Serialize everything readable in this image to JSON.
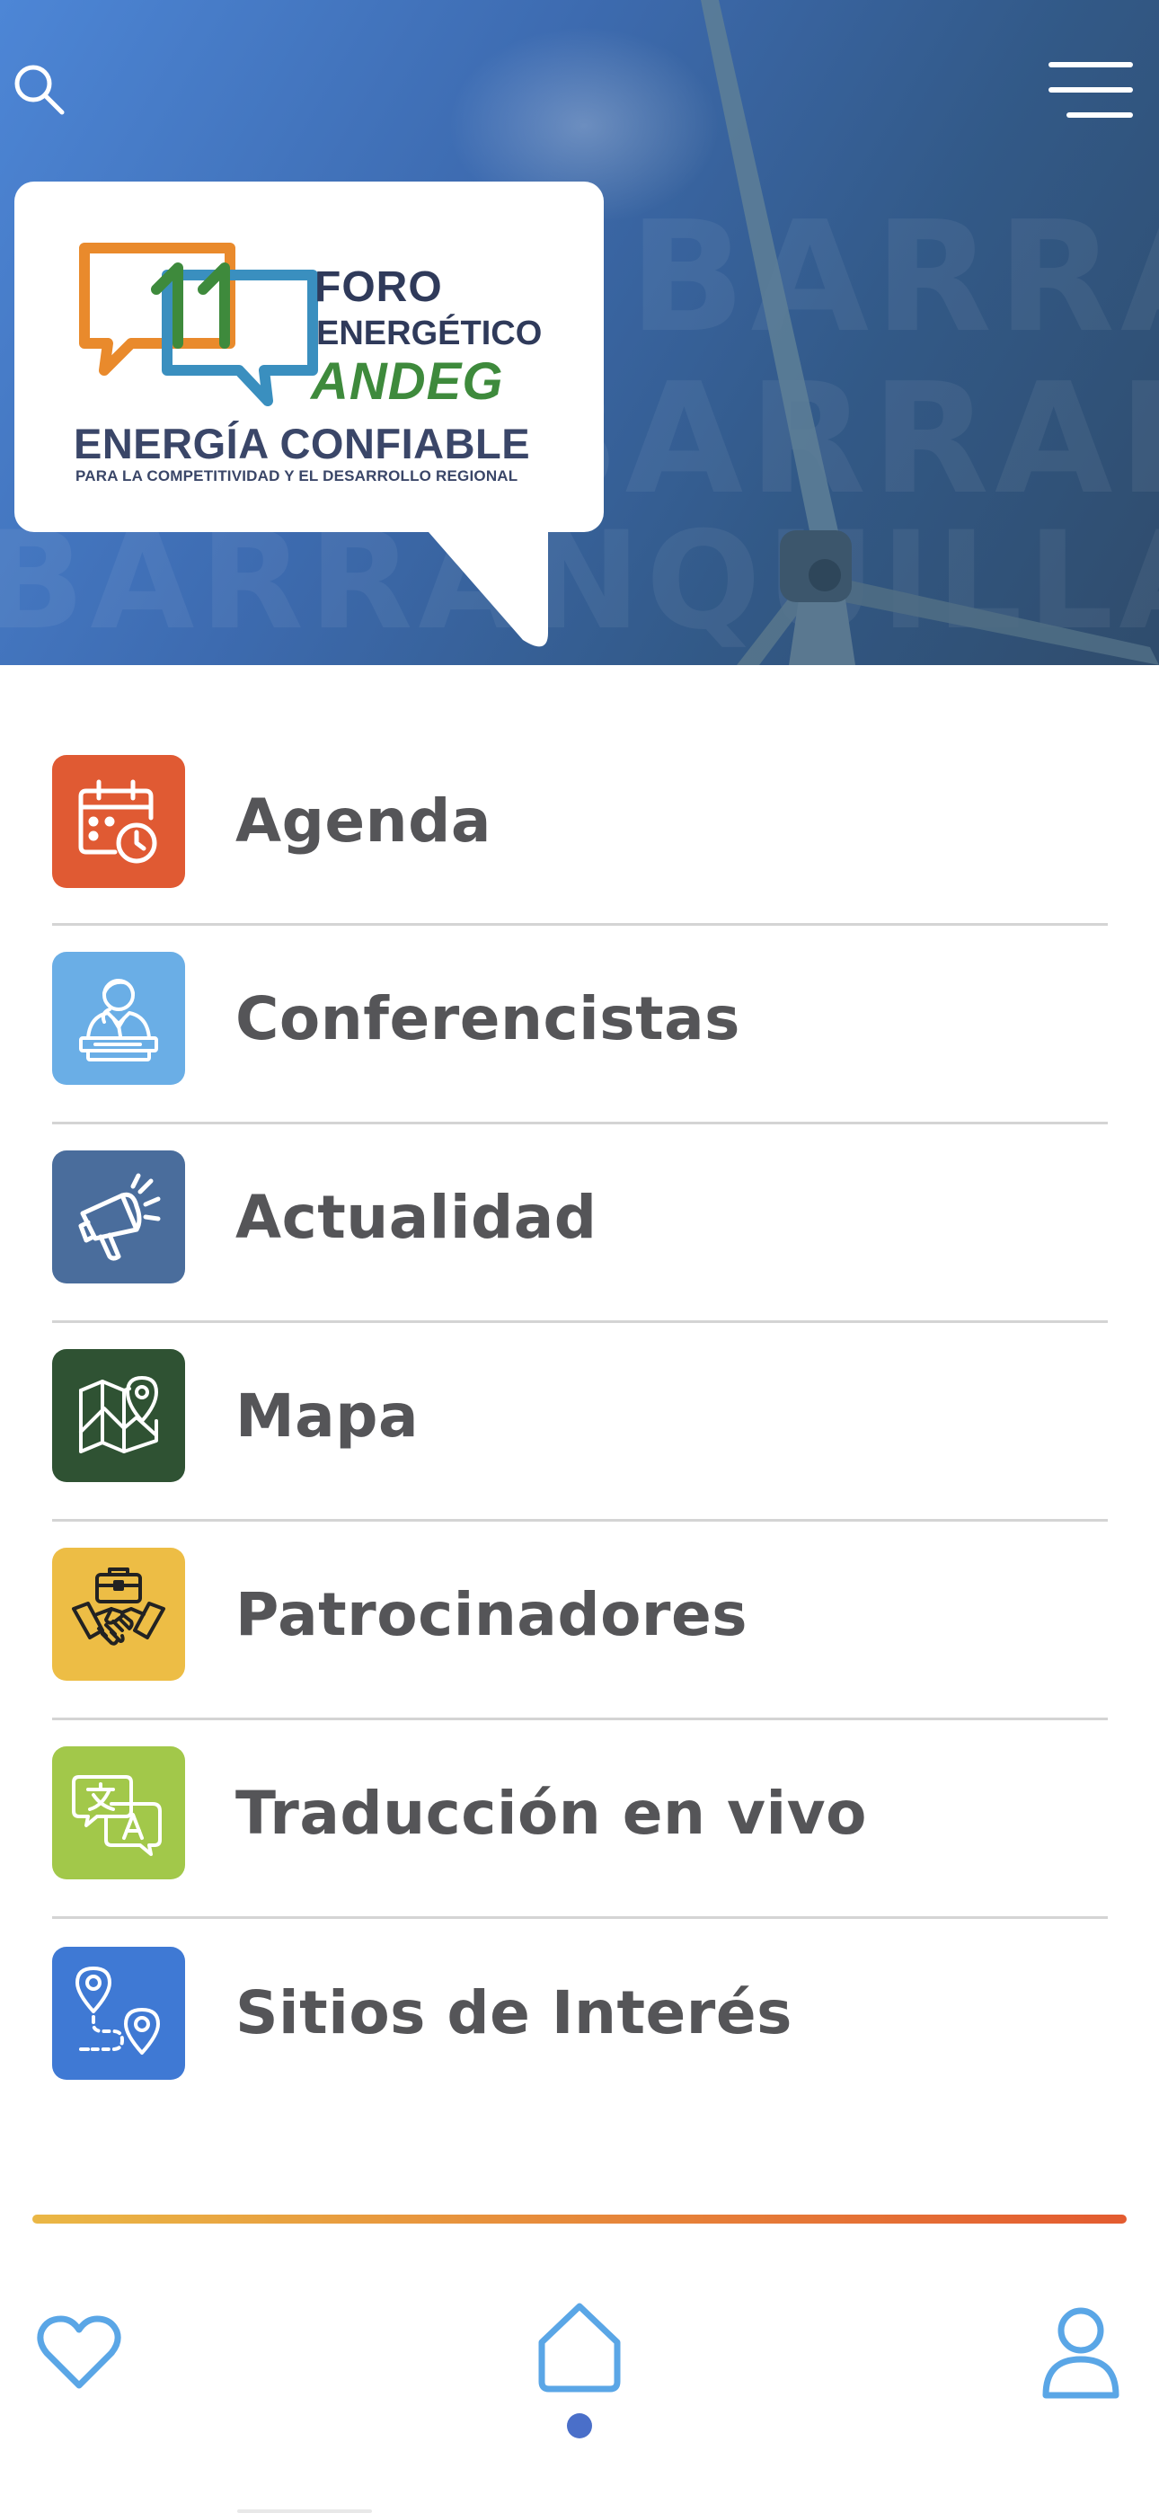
{
  "header": {
    "watermark": "BARRANQUILLA",
    "search_icon": "search-icon",
    "menu_icon": "hamburger-menu-icon"
  },
  "logo": {
    "edition_number": "11",
    "line1": "FORO",
    "line2": "ENERGÉTICO",
    "line3": "ANDEG",
    "tagline": "ENERGÍA CONFIABLE",
    "subtitle": "PARA LA COMPETITIVIDAD Y EL DESARROLLO REGIONAL"
  },
  "menu": {
    "items": [
      {
        "label": "Agenda",
        "icon": "calendar-clock-icon",
        "color": "#e05a33"
      },
      {
        "label": "Conferencistas",
        "icon": "speaker-podium-icon",
        "color": "#6aaee6"
      },
      {
        "label": "Actualidad",
        "icon": "megaphone-icon",
        "color": "#4a6d9c"
      },
      {
        "label": "Mapa",
        "icon": "map-pin-icon",
        "color": "#2f5233"
      },
      {
        "label": "Patrocinadores",
        "icon": "handshake-briefcase-icon",
        "color": "#edbd45"
      },
      {
        "label": "Traducción en vivo",
        "icon": "translate-icon",
        "color": "#a2c84a"
      },
      {
        "label": "Sitios de Interés",
        "icon": "route-pins-icon",
        "color": "#3f79d4"
      }
    ]
  },
  "tabbar": {
    "items": [
      {
        "icon": "heart-icon",
        "active": false
      },
      {
        "icon": "home-icon",
        "active": true
      },
      {
        "icon": "user-icon",
        "active": false
      }
    ],
    "active_color": "#4a6fc9",
    "icon_color": "#5aa6e6",
    "accent_gradient": [
      "#eab745",
      "#e35b30"
    ]
  }
}
